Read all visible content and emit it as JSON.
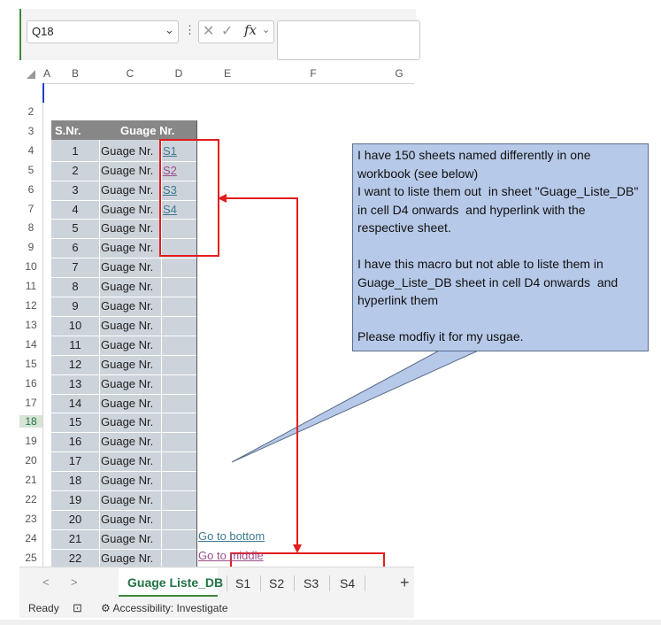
{
  "namebox": {
    "value": "Q18",
    "arrow": "⌄"
  },
  "formula_bar": {
    "dots": "⋮",
    "cancel": "✕",
    "enter": "✓",
    "fx": "fx",
    "fx_arrow": "⌄"
  },
  "columns": [
    "A",
    "B",
    "C",
    "D",
    "E",
    "F",
    "G"
  ],
  "rows": [
    "2",
    "3",
    "4",
    "5",
    "6",
    "7",
    "8",
    "9",
    "10",
    "11",
    "12",
    "13",
    "14",
    "15",
    "16",
    "17",
    "18",
    "19",
    "20",
    "21",
    "22",
    "23",
    "24",
    "25"
  ],
  "active_row": "18",
  "table": {
    "header_snr": "S.Nr.",
    "header_gauge": "Guage Nr.",
    "rows": [
      {
        "n": "1",
        "g": "Guage Nr."
      },
      {
        "n": "2",
        "g": "Guage Nr."
      },
      {
        "n": "3",
        "g": "Guage Nr."
      },
      {
        "n": "4",
        "g": "Guage Nr."
      },
      {
        "n": "5",
        "g": "Guage Nr."
      },
      {
        "n": "6",
        "g": "Guage Nr."
      },
      {
        "n": "7",
        "g": "Guage Nr."
      },
      {
        "n": "8",
        "g": "Guage Nr."
      },
      {
        "n": "9",
        "g": "Guage Nr."
      },
      {
        "n": "10",
        "g": "Guage Nr."
      },
      {
        "n": "11",
        "g": "Guage Nr."
      },
      {
        "n": "12",
        "g": "Guage Nr."
      },
      {
        "n": "13",
        "g": "Guage Nr."
      },
      {
        "n": "14",
        "g": "Guage Nr."
      },
      {
        "n": "15",
        "g": "Guage Nr."
      },
      {
        "n": "16",
        "g": "Guage Nr."
      },
      {
        "n": "17",
        "g": "Guage Nr."
      },
      {
        "n": "18",
        "g": "Guage Nr."
      },
      {
        "n": "19",
        "g": "Guage Nr."
      },
      {
        "n": "20",
        "g": "Guage Nr."
      },
      {
        "n": "21",
        "g": "Guage Nr."
      },
      {
        "n": "22",
        "g": "Guage Nr."
      }
    ],
    "links": [
      {
        "text": "S1",
        "color": "#3e7a92"
      },
      {
        "text": "S2",
        "color": "#9b4f8a"
      },
      {
        "text": "S3",
        "color": "#3e7a92"
      },
      {
        "text": "S4",
        "color": "#3e7a92"
      }
    ]
  },
  "callout": {
    "text": "I have 150 sheets named differently in one workbook (see below)\nI want to liste them out  in sheet \"Guage_Liste_DB\"  in cell D4 onwards  and hyperlink with the respective sheet.\n\nI have this macro but not able to liste them in Guage_Liste_DB sheet in cell D4 onwards  and hyperlink them\n\nPlease modfiy it for my usgae."
  },
  "nav_links": {
    "go_bottom": "Go to bottom",
    "go_middle": "Go to middle"
  },
  "tabs": {
    "prev": "<",
    "next": ">",
    "active": "Guage Liste_DB",
    "others": [
      "S1",
      "S2",
      "S3",
      "S4"
    ],
    "add": "+"
  },
  "status": {
    "ready": "Ready",
    "accessibility": "Accessibility: Investigate"
  },
  "colors": {
    "accent": "#217346",
    "annotation_red": "#e41c1c",
    "callout_fill": "#b7c9e8",
    "table_fill": "#cdd3da"
  }
}
